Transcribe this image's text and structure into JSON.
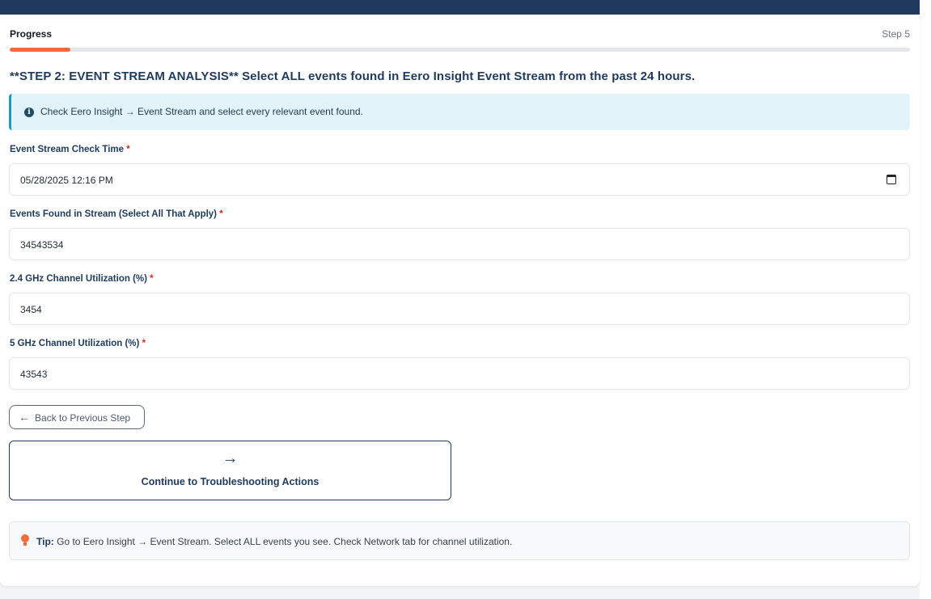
{
  "progress": {
    "label": "Progress",
    "step_text": "Step 5",
    "value_fraction": 0.067
  },
  "step_heading": "**STEP 2: EVENT STREAM ANALYSIS** Select ALL events found in Eero Insight Event Stream from the past 24 hours.",
  "info_banner": {
    "icon": "info-icon",
    "text": "Check Eero Insight → Event Stream and select every relevant event found."
  },
  "fields": [
    {
      "label": "Event Stream Check Time",
      "required_mark": "*",
      "value": "05/28/2025 12:16  PM",
      "icon": "calendar-icon"
    },
    {
      "label": "Events Found in Stream (Select All That Apply)",
      "required_mark": "*",
      "value": "34543534"
    },
    {
      "label": "2.4 GHz Channel Utilization (%)",
      "required_mark": "*",
      "value": "3454"
    },
    {
      "label": "5 GHz Channel Utilization (%)",
      "required_mark": "*",
      "value": "43543"
    }
  ],
  "back_button": {
    "label": "Back to Previous Step",
    "icon": "arrow-left-icon"
  },
  "continue_button": {
    "label": "Continue to Troubleshooting Actions",
    "icon": "arrow-right-icon"
  },
  "tip": {
    "icon": "lightbulb-icon",
    "label": "Tip:",
    "text": " Go to Eero Insight → Event Stream. Select ALL events you see. Check Network tab for channel utilization."
  },
  "colors": {
    "header_navy": "#1e3a5f",
    "accent_orange": "#f26b3a",
    "info_blue": "#1a9bc0",
    "required_red": "#dc2626"
  }
}
